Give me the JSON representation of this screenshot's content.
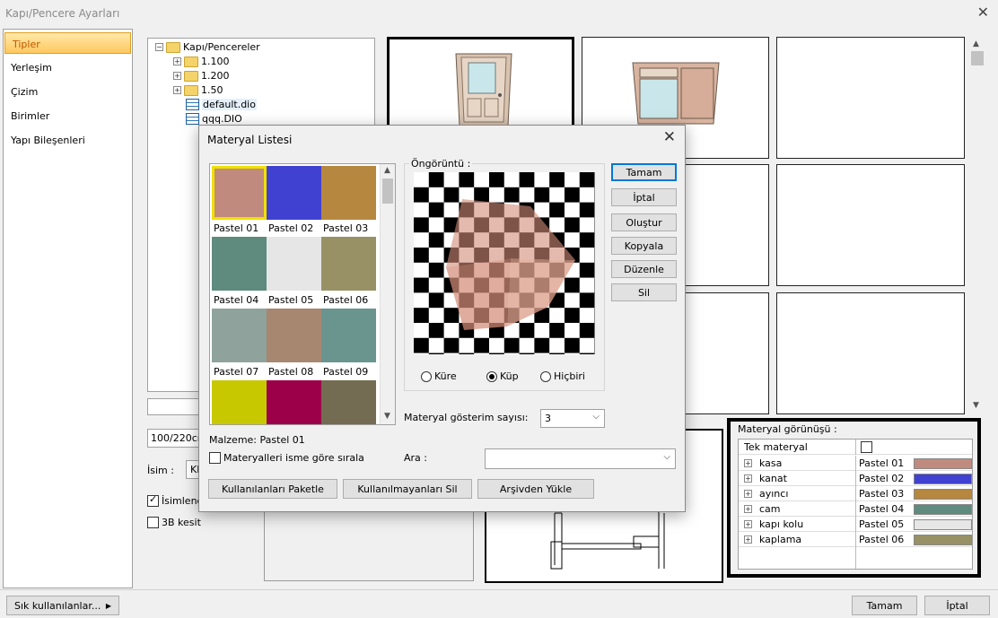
{
  "window": {
    "title": "Kapı/Pencere Ayarları",
    "close": "✕"
  },
  "sidebar": {
    "items": [
      {
        "label": "Tipler"
      },
      {
        "label": "Yerleşim"
      },
      {
        "label": "Çizim"
      },
      {
        "label": "Birimler"
      },
      {
        "label": "Yapı Bileşenleri"
      }
    ]
  },
  "tree": {
    "root": "Kapı/Pencereler",
    "folders": [
      "1.100",
      "1.200",
      "1.50"
    ],
    "files": [
      "default.dio",
      "qqq.DIO"
    ]
  },
  "left_form": {
    "size_value": "100/220cm",
    "name_label": "İsim :",
    "name_value": "KI",
    "naming_label": "İsimlendir",
    "section_label": "3B kesit"
  },
  "material_view": {
    "title": "Materyal görünüşü :",
    "single_label": "Tek materyal",
    "rows": [
      {
        "name": "kasa",
        "value": "Pastel 01",
        "color": "#c08b7e"
      },
      {
        "name": "kanat",
        "value": "Pastel 02",
        "color": "#4141d1"
      },
      {
        "name": "ayıncı",
        "value": "Pastel 03",
        "color": "#b6873f"
      },
      {
        "name": "cam",
        "value": "Pastel 04",
        "color": "#5e8b7e"
      },
      {
        "name": "kapı kolu",
        "value": "Pastel 05",
        "color": "#e6e6e6"
      },
      {
        "name": "kaplama",
        "value": "Pastel 06",
        "color": "#979165"
      }
    ]
  },
  "footer": {
    "frequent": "Sık kullanılanlar...",
    "ok": "Tamam",
    "cancel": "İptal"
  },
  "dialog": {
    "title": "Materyal Listesi",
    "close": "✕",
    "swatches": [
      {
        "name": "Pastel 01",
        "color": "#c08b7e"
      },
      {
        "name": "Pastel 02",
        "color": "#4141d1"
      },
      {
        "name": "Pastel 03",
        "color": "#b6873f"
      },
      {
        "name": "Pastel 04",
        "color": "#5e8b7e"
      },
      {
        "name": "Pastel 05",
        "color": "#e6e6e6"
      },
      {
        "name": "Pastel 06",
        "color": "#979165"
      },
      {
        "name": "Pastel 07",
        "color": "#8fa39c"
      },
      {
        "name": "Pastel 08",
        "color": "#a88770"
      },
      {
        "name": "Pastel 09",
        "color": "#6a958f"
      },
      {
        "name": "",
        "color": "#c8c800"
      },
      {
        "name": "",
        "color": "#9b0048"
      },
      {
        "name": "",
        "color": "#746c52"
      }
    ],
    "selected_material": "Malzeme: Pastel 01",
    "sort_label": "Materyalleri isme göre sırala",
    "search_label": "Ara :",
    "search_value": "",
    "preview_label": "Öngörüntü :",
    "preview_options": [
      "Küre",
      "Küp",
      "Hiçbiri"
    ],
    "preview_selected": "Küp",
    "count_label": "Materyal gösterim sayısı:",
    "count_value": "3",
    "buttons": {
      "ok": "Tamam",
      "cancel": "İptal",
      "create": "Oluştur",
      "copy": "Kopyala",
      "edit": "Düzenle",
      "delete": "Sil"
    },
    "bottom_buttons": {
      "pack": "Kullanılanları Paketle",
      "remove_unused": "Kullanılmayanları Sil",
      "load_archive": "Arşivden Yükle"
    }
  }
}
